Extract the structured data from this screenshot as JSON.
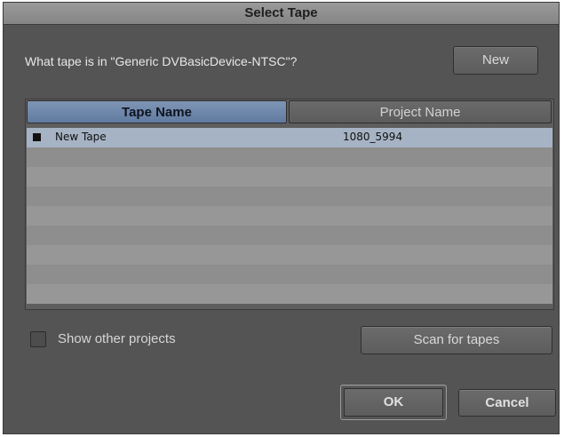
{
  "dialog": {
    "title": "Select Tape",
    "question": "What tape is in \"Generic DVBasicDevice-NTSC\"?",
    "new_button": "New"
  },
  "table": {
    "columns": [
      "Tape Name",
      "Project Name"
    ],
    "rows": [
      {
        "tape_name": "New Tape",
        "project_name": "1080_5994",
        "selected": true
      }
    ]
  },
  "options": {
    "show_other_projects_label": "Show other projects",
    "show_other_projects_checked": false
  },
  "actions": {
    "scan_label": "Scan for tapes",
    "ok_label": "OK",
    "cancel_label": "Cancel"
  },
  "colors": {
    "dialog_bg": "#545454",
    "header_selected": "#6f87ab",
    "row_selected": "#a6b3c4"
  }
}
